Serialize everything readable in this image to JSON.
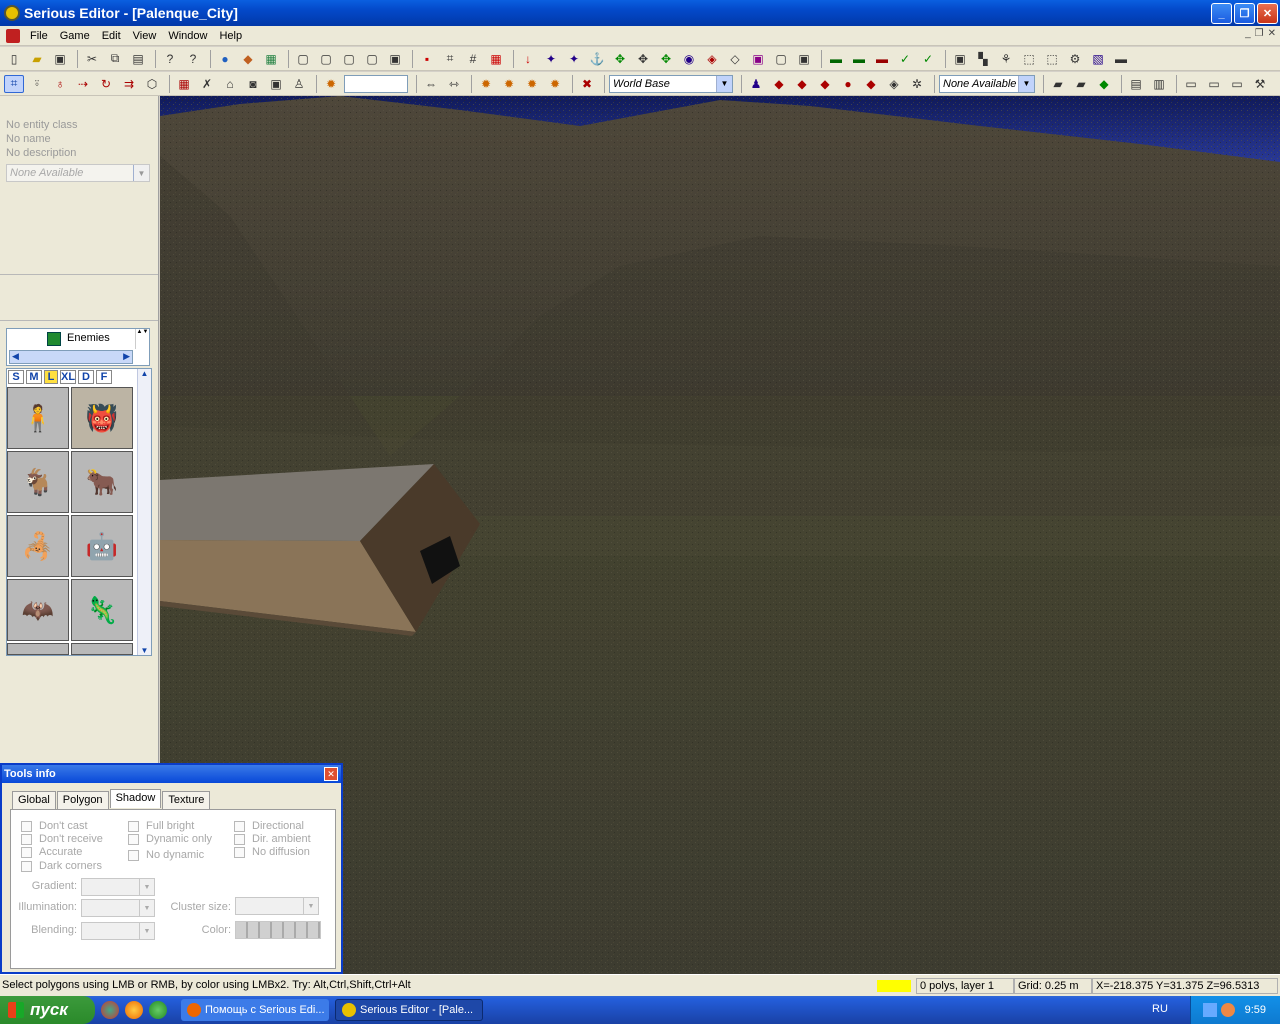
{
  "window": {
    "title": "Serious Editor - [Palenque_City]"
  },
  "menu": [
    "File",
    "Game",
    "Edit",
    "View",
    "Window",
    "Help"
  ],
  "toolbar2": {
    "world_combo": "World Base",
    "none_combo": "None Available"
  },
  "entity_info": {
    "cls": "No entity class",
    "name": "No name",
    "desc": "No description",
    "combo": "None Available"
  },
  "browser": {
    "folder": "Enemies",
    "size_tabs": [
      "S",
      "M",
      "L",
      "XL",
      "D",
      "F"
    ]
  },
  "tools_info": {
    "title": "Tools info",
    "tabs": [
      "Global",
      "Polygon",
      "Shadow",
      "Texture"
    ],
    "active_tab": "Shadow",
    "col1": [
      "Don't cast",
      "Don't receive",
      "Accurate",
      "Dark corners"
    ],
    "col2": [
      "Full bright",
      "Dynamic only",
      "No dynamic"
    ],
    "col3": [
      "Directional",
      "Dir. ambient",
      "No diffusion"
    ],
    "fields": {
      "gradient": "Gradient:",
      "illumination": "Illumination:",
      "blending": "Blending:",
      "cluster": "Cluster size:",
      "color": "Color:"
    }
  },
  "status": {
    "hint": "Select polygons using LMB or RMB, by color using LMBx2. Try: Alt,Ctrl,Shift,Ctrl+Alt",
    "polys": "0 polys, layer 1",
    "grid": "Grid: 0.25 m",
    "coords": "X=-218.375 Y=31.375 Z=96.5313",
    "indicator_color": "#ffff00"
  },
  "taskbar": {
    "start": "пуск",
    "tasks": [
      "Помощь с Serious Edi...",
      "Serious Editor - [Pale..."
    ],
    "lang": "RU",
    "time": "9:59"
  }
}
